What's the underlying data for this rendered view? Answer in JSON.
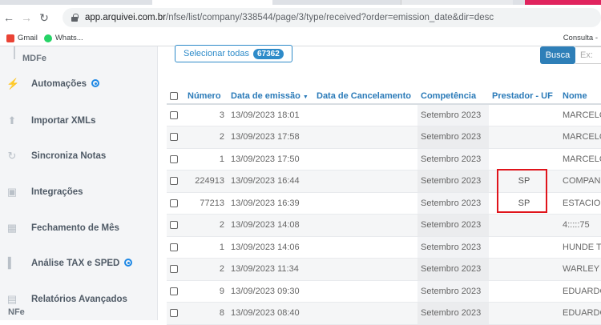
{
  "browser": {
    "back_icon": "arrow-left-icon",
    "forward_icon": "arrow-right-icon",
    "reload_icon": "reload-icon",
    "url_host": "app.arquivei.com.br",
    "url_path": "/nfse/list/company/338544/page/3/type/received?order=emission_date&dir=desc"
  },
  "bookmarks": {
    "items": [
      {
        "label": "Gmail"
      },
      {
        "label": "Whats..."
      }
    ],
    "right_label": "Consulta -"
  },
  "sidebar": {
    "top_label": "MDFe",
    "items": [
      {
        "label": "Automações",
        "icon": "bolt-icon",
        "badge": true
      },
      {
        "label": "Importar XMLs",
        "icon": "upload-icon",
        "badge": false
      },
      {
        "label": "Sincroniza Notas",
        "icon": "sync-icon",
        "badge": false
      },
      {
        "label": "Integrações",
        "icon": "puzzle-icon",
        "badge": false
      },
      {
        "label": "Fechamento de Mês",
        "icon": "calendar-icon",
        "badge": false
      },
      {
        "label": "Análise TAX e SPED",
        "icon": "bar-chart-icon",
        "badge": true
      },
      {
        "label": "Relatórios Avançados",
        "icon": "report-icon",
        "badge": false
      }
    ],
    "bottom_label": "NFe"
  },
  "toolbar": {
    "select_all_label": "Selecionar todas",
    "select_all_count": "67362",
    "search_button": "Busca",
    "search_placeholder": "Ex:"
  },
  "table": {
    "headers": {
      "numero": "Número",
      "emissao": "Data de emissão",
      "cancelamento": "Data de Cancelamento",
      "competencia": "Competência",
      "prestador_uf": "Prestador - UF",
      "nome": "Nome"
    },
    "rows": [
      {
        "numero": "3",
        "emissao": "13/09/2023 18:01",
        "cancelamento": "",
        "competencia": "Setembro 2023",
        "uf": "",
        "nome": "MARCELO"
      },
      {
        "numero": "2",
        "emissao": "13/09/2023 17:58",
        "cancelamento": "",
        "competencia": "Setembro 2023",
        "uf": "",
        "nome": "MARCELO"
      },
      {
        "numero": "1",
        "emissao": "13/09/2023 17:50",
        "cancelamento": "",
        "competencia": "Setembro 2023",
        "uf": "",
        "nome": "MARCELO"
      },
      {
        "numero": "224913",
        "emissao": "13/09/2023 16:44",
        "cancelamento": "",
        "competencia": "Setembro 2023",
        "uf": "SP",
        "nome": "COMPAN"
      },
      {
        "numero": "77213",
        "emissao": "13/09/2023 16:39",
        "cancelamento": "",
        "competencia": "Setembro 2023",
        "uf": "SP",
        "nome": "ESTACIO"
      },
      {
        "numero": "2",
        "emissao": "13/09/2023 14:08",
        "cancelamento": "",
        "competencia": "Setembro 2023",
        "uf": "",
        "nome": "4:::::75"
      },
      {
        "numero": "1",
        "emissao": "13/09/2023 14:06",
        "cancelamento": "",
        "competencia": "Setembro 2023",
        "uf": "",
        "nome": "HUNDE T"
      },
      {
        "numero": "2",
        "emissao": "13/09/2023 11:34",
        "cancelamento": "",
        "competencia": "Setembro 2023",
        "uf": "",
        "nome": "WARLEY"
      },
      {
        "numero": "9",
        "emissao": "13/09/2023 09:30",
        "cancelamento": "",
        "competencia": "Setembro 2023",
        "uf": "",
        "nome": "EDUARDO"
      },
      {
        "numero": "8",
        "emissao": "13/09/2023 08:40",
        "cancelamento": "",
        "competencia": "Setembro 2023",
        "uf": "",
        "nome": "EDUARDO"
      }
    ]
  },
  "colors": {
    "accent": "#2e8bc9",
    "highlight": "#e0141b"
  }
}
